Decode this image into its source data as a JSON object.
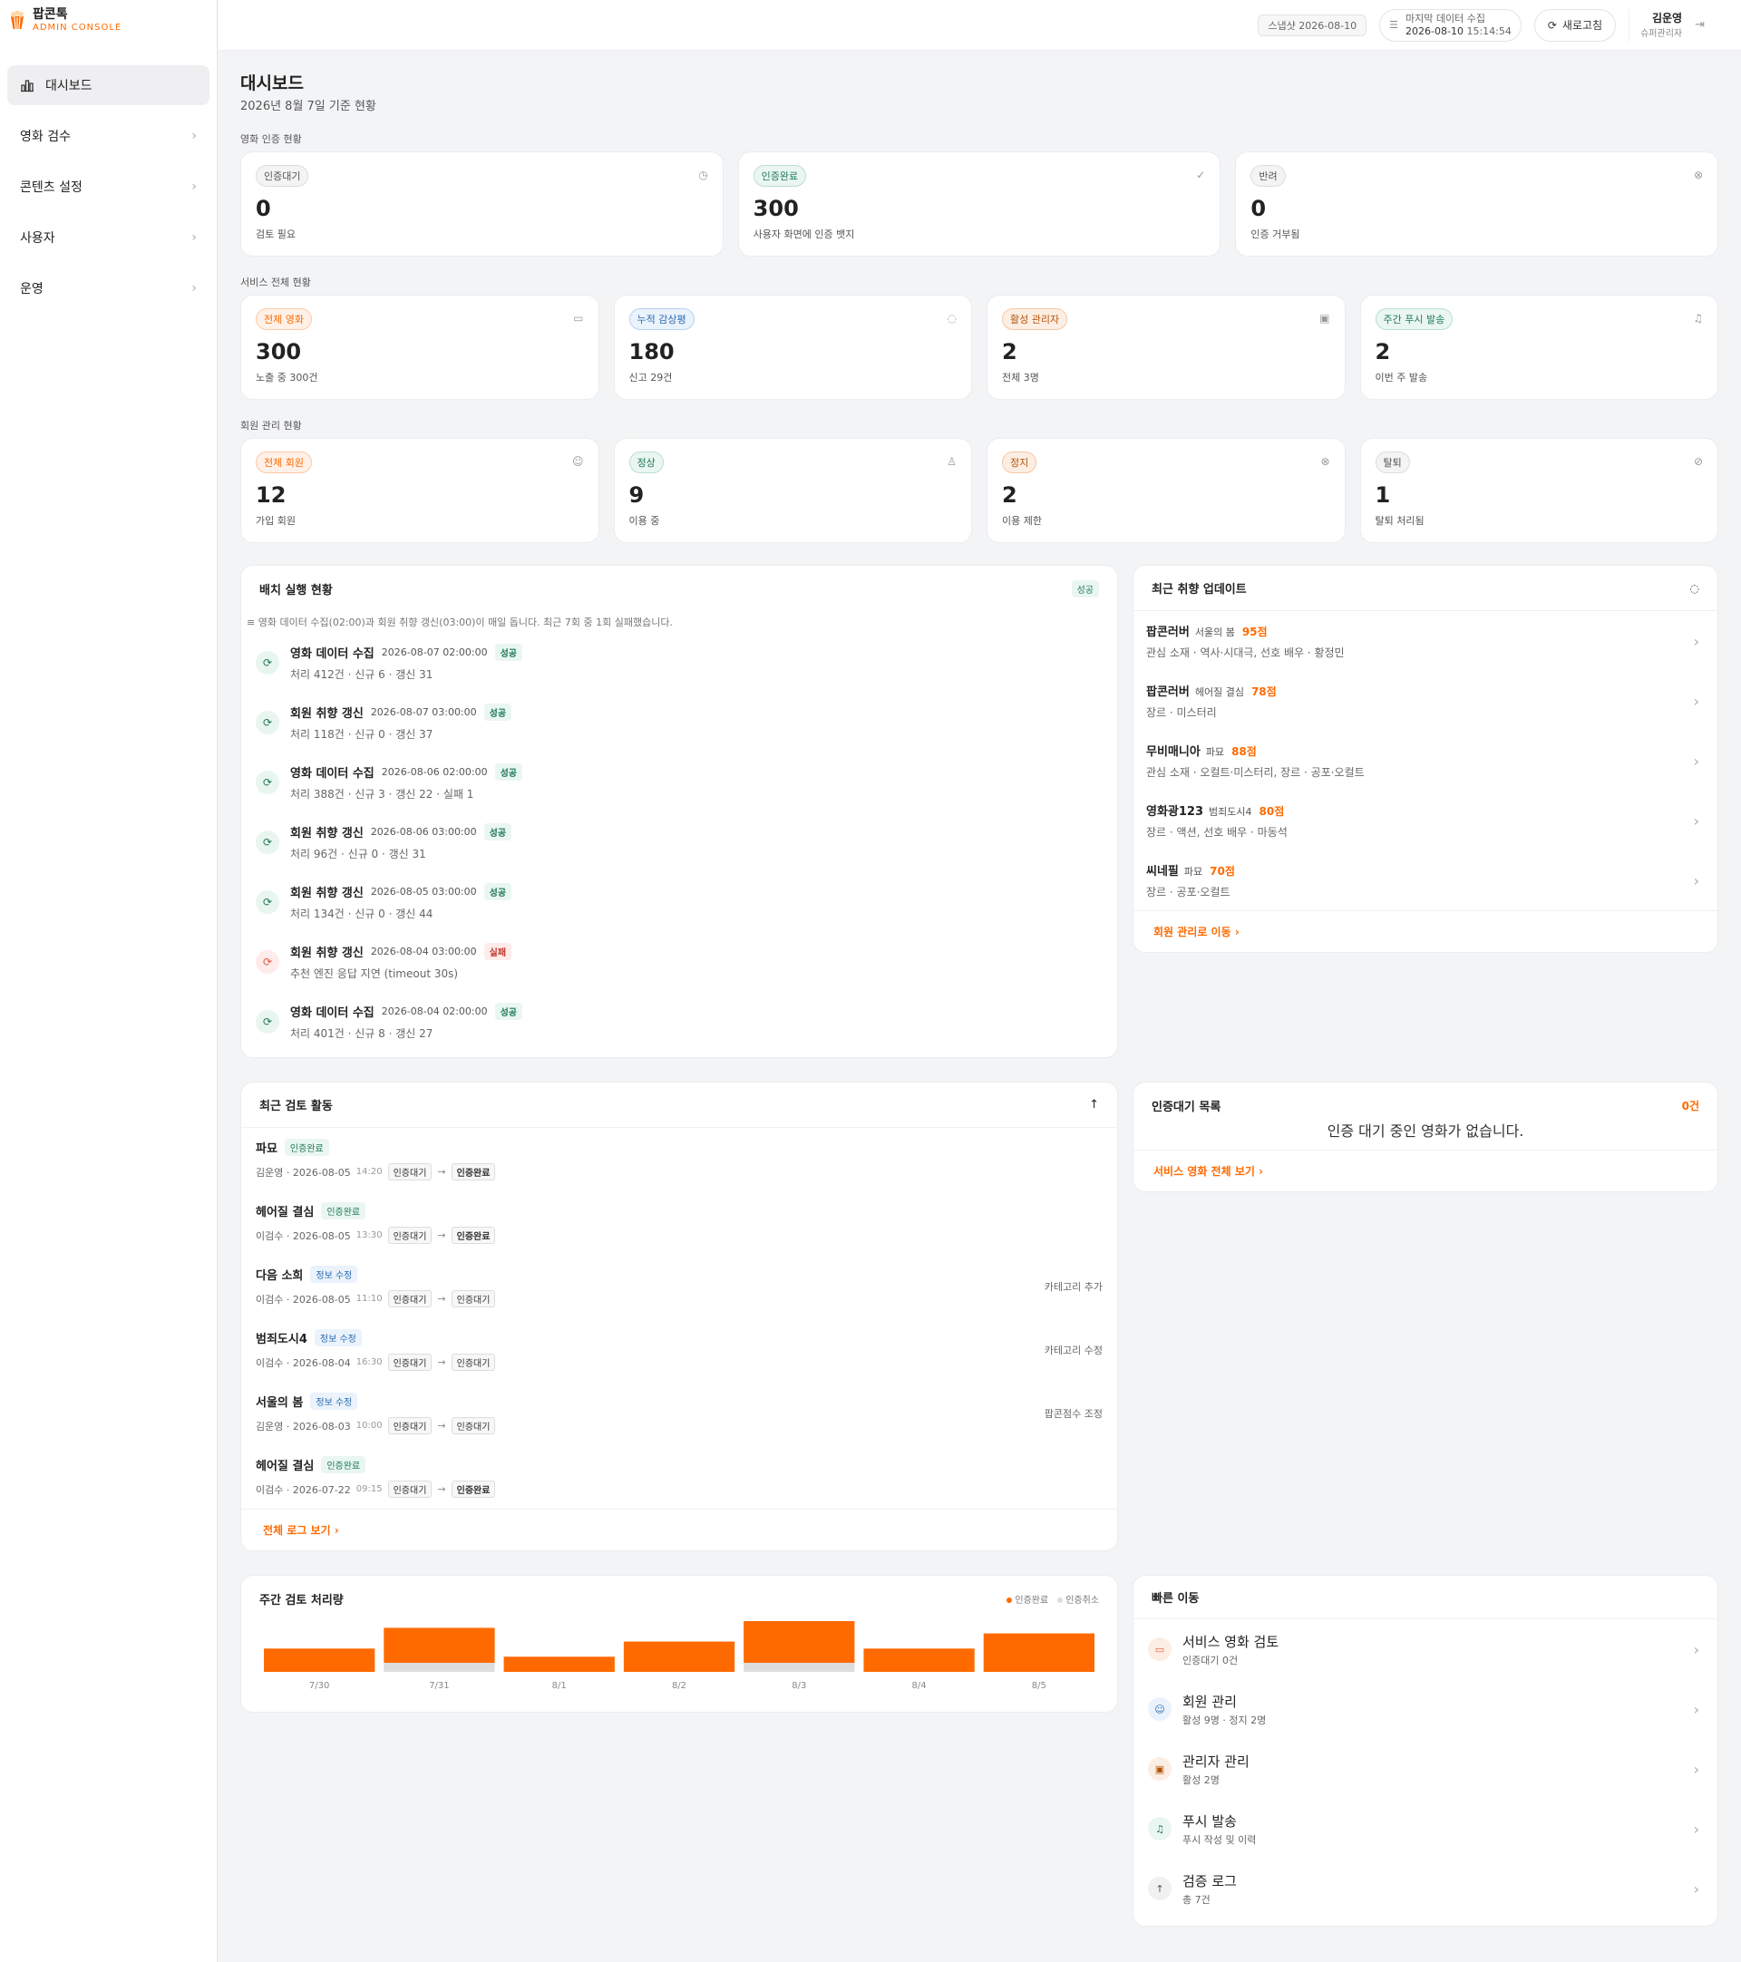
{
  "brand": {
    "name": "팝콘톡",
    "sub": "ADMIN CONSOLE"
  },
  "nav": [
    {
      "label": "대시보드",
      "icon": "bar-chart-icon",
      "active": true
    },
    {
      "label": "영화 검수",
      "icon": "",
      "active": false
    },
    {
      "label": "콘텐츠 설정",
      "icon": "",
      "active": false
    },
    {
      "label": "사용자",
      "icon": "",
      "active": false
    },
    {
      "label": "운영",
      "icon": "",
      "active": false
    }
  ],
  "topbar": {
    "snapshot": "스냅샷 2026-08-10",
    "last_collect_label": "마지막 데이터 수집",
    "last_collect_date": "2026-08-10",
    "last_collect_time": "15:14:54",
    "refresh": "새로고침",
    "user_name": "김운영",
    "user_role": "슈퍼관리자"
  },
  "page": {
    "title": "대시보드",
    "subtitle": "2026년 8월 7일 기준 현황"
  },
  "cert": {
    "label": "영화 인증 현황",
    "cards": [
      {
        "tag": "인증대기",
        "value": "0",
        "desc": "검토 필요",
        "icon": "clock-icon"
      },
      {
        "tag": "인증완료",
        "value": "300",
        "desc": "사용자 화면에 인증 뱃지",
        "icon": "check-icon"
      },
      {
        "tag": "반려",
        "value": "0",
        "desc": "인증 거부됨",
        "icon": "x-circle-icon"
      }
    ]
  },
  "service": {
    "label": "서비스 전체 현황",
    "cards": [
      {
        "tag": "전체 영화",
        "value": "300",
        "desc": "노출 중 300건",
        "icon": "film-icon"
      },
      {
        "tag": "누적 감상평",
        "value": "180",
        "desc": "신고 29건",
        "icon": "chat-icon"
      },
      {
        "tag": "활성 관리자",
        "value": "2",
        "desc": "전체 3명",
        "icon": "briefcase-icon"
      },
      {
        "tag": "주간 푸시 발송",
        "value": "2",
        "desc": "이번 주 발송",
        "icon": "bell-icon"
      }
    ]
  },
  "members": {
    "label": "회원 관리 현황",
    "cards": [
      {
        "tag": "전체 회원",
        "value": "12",
        "desc": "가입 회원",
        "icon": "users-icon"
      },
      {
        "tag": "정상",
        "value": "9",
        "desc": "이용 중",
        "icon": "user-icon"
      },
      {
        "tag": "정지",
        "value": "2",
        "desc": "이용 제한",
        "icon": "x-circle-icon"
      },
      {
        "tag": "탈퇴",
        "value": "1",
        "desc": "탈퇴 처리됨",
        "icon": "eye-off-icon"
      }
    ]
  },
  "batch": {
    "title": "배치 실행 현황",
    "status": "성공",
    "note": "영화 데이터 수집(02:00)과 회원 취향 갱신(03:00)이 매일 돕니다. 최근 7회 중 1회 실패했습니다.",
    "items": [
      {
        "name": "영화 데이터 수집",
        "time": "2026-08-07 02:00:00",
        "status": "성공",
        "detail": "처리 412건 · 신규 6 · 갱신 31",
        "fail": false
      },
      {
        "name": "회원 취향 갱신",
        "time": "2026-08-07 03:00:00",
        "status": "성공",
        "detail": "처리 118건 · 신규 0 · 갱신 37",
        "fail": false
      },
      {
        "name": "영화 데이터 수집",
        "time": "2026-08-06 02:00:00",
        "status": "성공",
        "detail": "처리 388건 · 신규 3 · 갱신 22 · 실패 1",
        "fail": false
      },
      {
        "name": "회원 취향 갱신",
        "time": "2026-08-06 03:00:00",
        "status": "성공",
        "detail": "처리 96건 · 신규 0 · 갱신 31",
        "fail": false
      },
      {
        "name": "회원 취향 갱신",
        "time": "2026-08-05 03:00:00",
        "status": "성공",
        "detail": "처리 134건 · 신규 0 · 갱신 44",
        "fail": false
      },
      {
        "name": "회원 취향 갱신",
        "time": "2026-08-04 03:00:00",
        "status": "실패",
        "detail": "추천 엔진 응답 지연 (timeout 30s)",
        "fail": true
      },
      {
        "name": "영화 데이터 수집",
        "time": "2026-08-04 02:00:00",
        "status": "성공",
        "detail": "처리 401건 · 신규 8 · 갱신 27",
        "fail": false
      }
    ]
  },
  "taste": {
    "title": "최근 취향 업데이트",
    "link": "회원 관리로 이동",
    "items": [
      {
        "user": "팝콘러버",
        "movie": "서울의 봄",
        "score": "95점",
        "detail": "관심 소재 · 역사·시대극, 선호 배우 · 황정민"
      },
      {
        "user": "팝콘러버",
        "movie": "헤어질 결심",
        "score": "78점",
        "detail": "장르 · 미스터리"
      },
      {
        "user": "무비매니아",
        "movie": "파묘",
        "score": "88점",
        "detail": "관심 소재 · 오컬트·미스터리, 장르 · 공포·오컬트"
      },
      {
        "user": "영화광123",
        "movie": "범죄도시4",
        "score": "80점",
        "detail": "장르 · 액션, 선호 배우 · 마동석"
      },
      {
        "user": "씨네필",
        "movie": "파묘",
        "score": "70점",
        "detail": "장르 · 공포·오컬트"
      }
    ]
  },
  "review": {
    "title": "최근 검토 활동",
    "link": "전체 로그 보기",
    "items": [
      {
        "movie": "파묘",
        "status": "인증완료",
        "edit": false,
        "who": "김운영 · 2026-08-05",
        "hm": "14:20",
        "from": "인증대기",
        "to": "인증완료",
        "to_done": true,
        "note": ""
      },
      {
        "movie": "헤어질 결심",
        "status": "인증완료",
        "edit": false,
        "who": "이검수 · 2026-08-05",
        "hm": "13:30",
        "from": "인증대기",
        "to": "인증완료",
        "to_done": true,
        "note": ""
      },
      {
        "movie": "다음 소희",
        "status": "정보 수정",
        "edit": true,
        "who": "이검수 · 2026-08-05",
        "hm": "11:10",
        "from": "인증대기",
        "to": "인증대기",
        "to_done": false,
        "note": "카테고리 추가"
      },
      {
        "movie": "범죄도시4",
        "status": "정보 수정",
        "edit": true,
        "who": "이검수 · 2026-08-04",
        "hm": "16:30",
        "from": "인증대기",
        "to": "인증대기",
        "to_done": false,
        "note": "카테고리 수정"
      },
      {
        "movie": "서울의 봄",
        "status": "정보 수정",
        "edit": true,
        "who": "김운영 · 2026-08-03",
        "hm": "10:00",
        "from": "인증대기",
        "to": "인증대기",
        "to_done": false,
        "note": "팝콘점수 조정"
      },
      {
        "movie": "헤어질 결심",
        "status": "인증완료",
        "edit": false,
        "who": "이검수 · 2026-07-22",
        "hm": "09:15",
        "from": "인증대기",
        "to": "인증완료",
        "to_done": true,
        "note": ""
      }
    ]
  },
  "pending": {
    "title": "인증대기 목록",
    "count": "0건",
    "empty": "인증 대기 중인 영화가 없습니다.",
    "link": "서비스 영화 전체 보기"
  },
  "weekly": {
    "title": "주간 검토 처리량",
    "legend_done": "인증완료",
    "legend_cancel": "인증취소",
    "colors": {
      "done": "#ff6a00",
      "cancel": "#dddddd"
    }
  },
  "chart_data": {
    "type": "bar",
    "title": "주간 검토 처리량",
    "categories": [
      "7/30",
      "7/31",
      "8/1",
      "8/2",
      "8/3",
      "8/4",
      "8/5"
    ],
    "series": [
      {
        "name": "인증완료",
        "values": [
          2,
          3,
          1.3,
          2.6,
          3.8,
          2,
          3.3
        ]
      },
      {
        "name": "인증취소",
        "values": [
          0,
          1,
          0,
          0,
          1,
          0,
          0
        ]
      }
    ],
    "stacked": true
  },
  "quick": {
    "title": "빠른 이동",
    "items": [
      {
        "title": "서비스 영화 검토",
        "desc": "인증대기 0건",
        "icon": "film-icon",
        "bg": "#fdeee3",
        "fg": "#e05a3a"
      },
      {
        "title": "회원 관리",
        "desc": "활성 9명 · 정지 2명",
        "icon": "users-icon",
        "bg": "#eaf2fc",
        "fg": "#2b6cb0"
      },
      {
        "title": "관리자 관리",
        "desc": "활성 2명",
        "icon": "briefcase-icon",
        "bg": "#fdeee3",
        "fg": "#b45309"
      },
      {
        "title": "푸시 발송",
        "desc": "푸시 작성 및 이력",
        "icon": "bell-icon",
        "bg": "#eaf6f1",
        "fg": "#1f7a57"
      },
      {
        "title": "검증 로그",
        "desc": "총 7건",
        "icon": "arrow-up-icon",
        "bg": "#f1f1f1",
        "fg": "#555"
      }
    ]
  }
}
